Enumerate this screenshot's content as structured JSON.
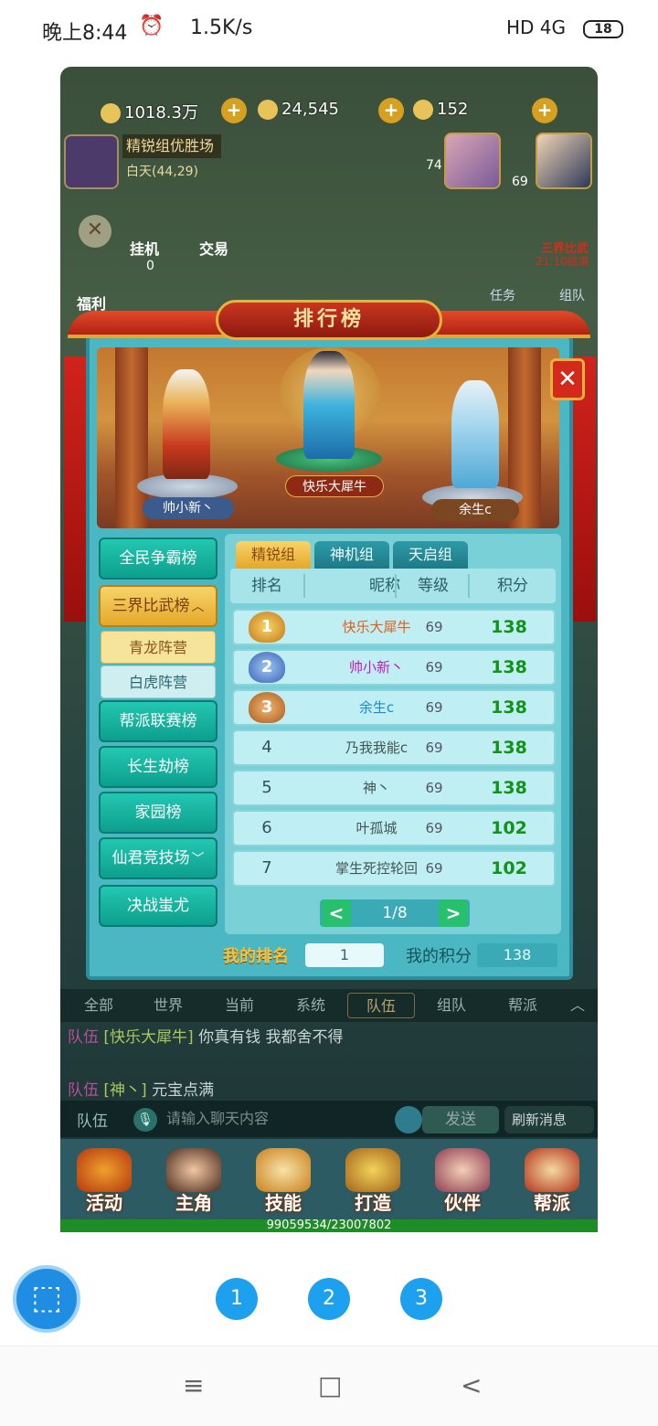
{
  "status_bar": {
    "time": "晚上8:44",
    "alarm_icon": "alarm-icon",
    "speed": "1.5K/s",
    "network": "HD 4G",
    "battery": "18"
  },
  "game": {
    "resources": [
      {
        "icon": "silver-coin-icon",
        "value": "1018.3万"
      },
      {
        "icon": "gold-coin-icon",
        "value": "24,545"
      },
      {
        "icon": "ingot-icon",
        "value": "152"
      }
    ],
    "map": {
      "title": "精锐组优胜场",
      "subtitle": "白天(44,29)"
    },
    "pet_level": "74",
    "hero_level": "69",
    "hang_label": "挂机",
    "hang_value": "0",
    "trade_label": "交易",
    "welfare_label": "福利",
    "event_label": "三界比武",
    "event_time": "21:10结束",
    "task_label": "任务",
    "team_label": "组队"
  },
  "leaderboard": {
    "title": "排行榜",
    "podium": [
      {
        "name": "帅小新丶",
        "place": 2
      },
      {
        "name": "快乐大犀牛",
        "place": 1
      },
      {
        "name": "余生c",
        "place": 3
      }
    ],
    "close_icon": "close-icon",
    "categories": [
      {
        "label": "全民争霸榜",
        "active": false
      },
      {
        "label": "三界比武榜",
        "active": true,
        "arrow": "︿"
      },
      {
        "label": "帮派联赛榜",
        "active": false
      },
      {
        "label": "长生劫榜",
        "active": false
      },
      {
        "label": "家园榜",
        "active": false
      },
      {
        "label": "仙君竞技场",
        "active": false,
        "arrow": "﹀"
      },
      {
        "label": "决战蚩尤",
        "active": false
      }
    ],
    "subcategories": [
      {
        "label": "青龙阵营",
        "selected": true
      },
      {
        "label": "白虎阵营",
        "selected": false
      }
    ],
    "group_tabs": [
      {
        "label": "精锐组",
        "active": true
      },
      {
        "label": "神机组",
        "active": false
      },
      {
        "label": "天启组",
        "active": false
      }
    ],
    "columns": [
      "排名",
      "昵称",
      "等级",
      "积分"
    ],
    "rows": [
      {
        "rank": "1",
        "name": "快乐大犀牛",
        "level": "69",
        "score": "138",
        "color": "#e05d1c",
        "medal": "gold"
      },
      {
        "rank": "2",
        "name": "帅小新丶",
        "level": "69",
        "score": "138",
        "color": "#c219c2",
        "medal": "silver"
      },
      {
        "rank": "3",
        "name": "余生c",
        "level": "69",
        "score": "138",
        "color": "#2187d6",
        "medal": "bronze"
      },
      {
        "rank": "4",
        "name": "乃我我能c",
        "level": "69",
        "score": "138",
        "color": "#445555"
      },
      {
        "rank": "5",
        "name": "神丶",
        "level": "69",
        "score": "138",
        "color": "#445555"
      },
      {
        "rank": "6",
        "name": "叶孤城",
        "level": "69",
        "score": "102",
        "color": "#445555"
      },
      {
        "rank": "7",
        "name": "掌生死控轮回",
        "level": "69",
        "score": "102",
        "color": "#445555"
      }
    ],
    "pager": {
      "current": "1/8",
      "prev": "<",
      "next": ">"
    },
    "my_rank_label": "我的排名",
    "my_rank_value": "1",
    "my_score_label": "我的积分",
    "my_score_value": "138"
  },
  "chat": {
    "tabs": [
      "全部",
      "世界",
      "当前",
      "系统",
      "队伍",
      "组队",
      "帮派"
    ],
    "selected_tab": "队伍",
    "messages": [
      {
        "channel": "队伍",
        "sender": "[快乐大犀牛]",
        "text": "你真有钱 我都舍不得"
      },
      {
        "channel": "队伍",
        "sender": "[神丶]",
        "text": "元宝点满"
      }
    ],
    "channel_label": "队伍",
    "input_placeholder": "请输入聊天内容",
    "send_label": "发送",
    "refresh_label": "刷新消息"
  },
  "bottom_menu": [
    {
      "label": "活动",
      "icon": "activity-gourd-icon"
    },
    {
      "label": "主角",
      "icon": "hero-portrait-icon"
    },
    {
      "label": "技能",
      "icon": "skill-book-icon"
    },
    {
      "label": "打造",
      "icon": "forge-anvil-icon"
    },
    {
      "label": "伙伴",
      "icon": "partners-icon"
    },
    {
      "label": "帮派",
      "icon": "guild-scroll-icon"
    }
  ],
  "exp_text": "99059534/23007802",
  "page_dots": [
    "1",
    "2",
    "3"
  ],
  "nav": {
    "menu": "≡",
    "home": "□",
    "back": "<"
  }
}
